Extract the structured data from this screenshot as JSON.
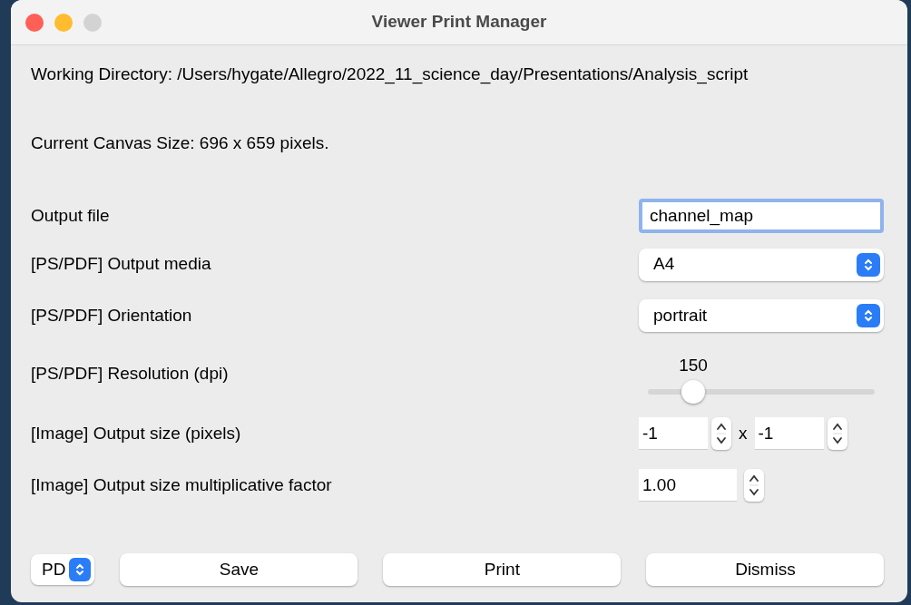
{
  "window": {
    "title": "Viewer Print Manager"
  },
  "info": [
    "Working Directory: /Users/hygate/Allegro/2022_11_science_day/Presentations/Analysis_script",
    "Current Canvas Size: 696 x 659 pixels."
  ],
  "rows": [
    {
      "kind": "text",
      "label": "Output file",
      "value": "channel_map",
      "focused": true
    },
    {
      "kind": "select",
      "label": "[PS/PDF] Output media",
      "value": "A4"
    },
    {
      "kind": "select",
      "label": "[PS/PDF] Orientation",
      "value": "portrait"
    },
    {
      "kind": "slider",
      "label": "[PS/PDF] Resolution (dpi)",
      "reading": "150",
      "level": 0.2
    },
    {
      "kind": "spinpair",
      "label": "[Image] Output size (pixels)",
      "values": [
        "-1",
        "-1"
      ],
      "separator": "x"
    },
    {
      "kind": "spin",
      "label": "[Image] Output size multiplicative factor",
      "values": [
        "1.00"
      ]
    }
  ],
  "footer": {
    "format": "PD",
    "buttons": [
      "Save",
      "Print",
      "Dismiss"
    ]
  }
}
